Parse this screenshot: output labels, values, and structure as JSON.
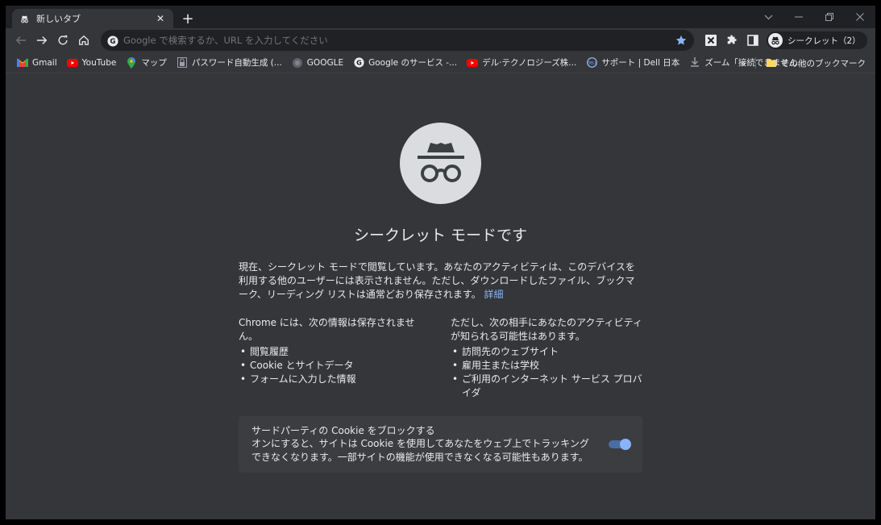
{
  "tab": {
    "title": "新しいタブ",
    "close": "✕",
    "new_tab": "+"
  },
  "window_controls": [
    "chevron-down",
    "minimize",
    "restore",
    "close"
  ],
  "omnibox": {
    "placeholder": "Google で検索するか、URL を入力してください"
  },
  "profile": {
    "label": "シークレット（2）"
  },
  "bookmarks": [
    {
      "label": "Gmail",
      "icon": "gmail-icon"
    },
    {
      "label": "YouTube",
      "icon": "youtube-icon"
    },
    {
      "label": "マップ",
      "icon": "maps-icon"
    },
    {
      "label": "パスワード自動生成 (...",
      "icon": "password-icon"
    },
    {
      "label": "GOOGLE",
      "icon": "globe-icon"
    },
    {
      "label": "Google のサービス -...",
      "icon": "google-icon"
    },
    {
      "label": "デル·テクノロジーズ株...",
      "icon": "youtube-icon"
    },
    {
      "label": "サポート | Dell 日本",
      "icon": "dell-icon"
    },
    {
      "label": "ズーム「接続できません...",
      "icon": "download-icon"
    }
  ],
  "bookmarks_more": "»",
  "other_bookmarks": "その他のブックマーク",
  "content": {
    "heading": "シークレット モードです",
    "description": "現在、シークレット モードで閲覧しています。あなたのアクティビティは、このデバイスを利用する他のユーザーには表示されません。ただし、ダウンロードしたファイル、ブックマーク、リーディング リストは通常どおり保存されます。",
    "learn_more": "詳細",
    "left_title": "Chrome には、次の情報は保存されません。",
    "left_items": [
      "閲覧履歴",
      "Cookie とサイトデータ",
      "フォームに入力した情報"
    ],
    "right_title": "ただし、次の相手にあなたのアクティビティが知られる可能性はあります。",
    "right_items": [
      "訪問先のウェブサイト",
      "雇用主または学校",
      "ご利用のインターネット サービス プロバイダ"
    ],
    "cookie_title": "サードパーティの Cookie をブロックする",
    "cookie_body": "オンにすると、サイトは Cookie を使用してあなたをウェブ上でトラッキングできなくなります。一部サイトの機能が使用できなくなる可能性もあります。",
    "cookie_toggle_on": true
  },
  "colors": {
    "background": "#35363a",
    "link": "#8ab4f8",
    "toggle": "#8ab4f8"
  }
}
